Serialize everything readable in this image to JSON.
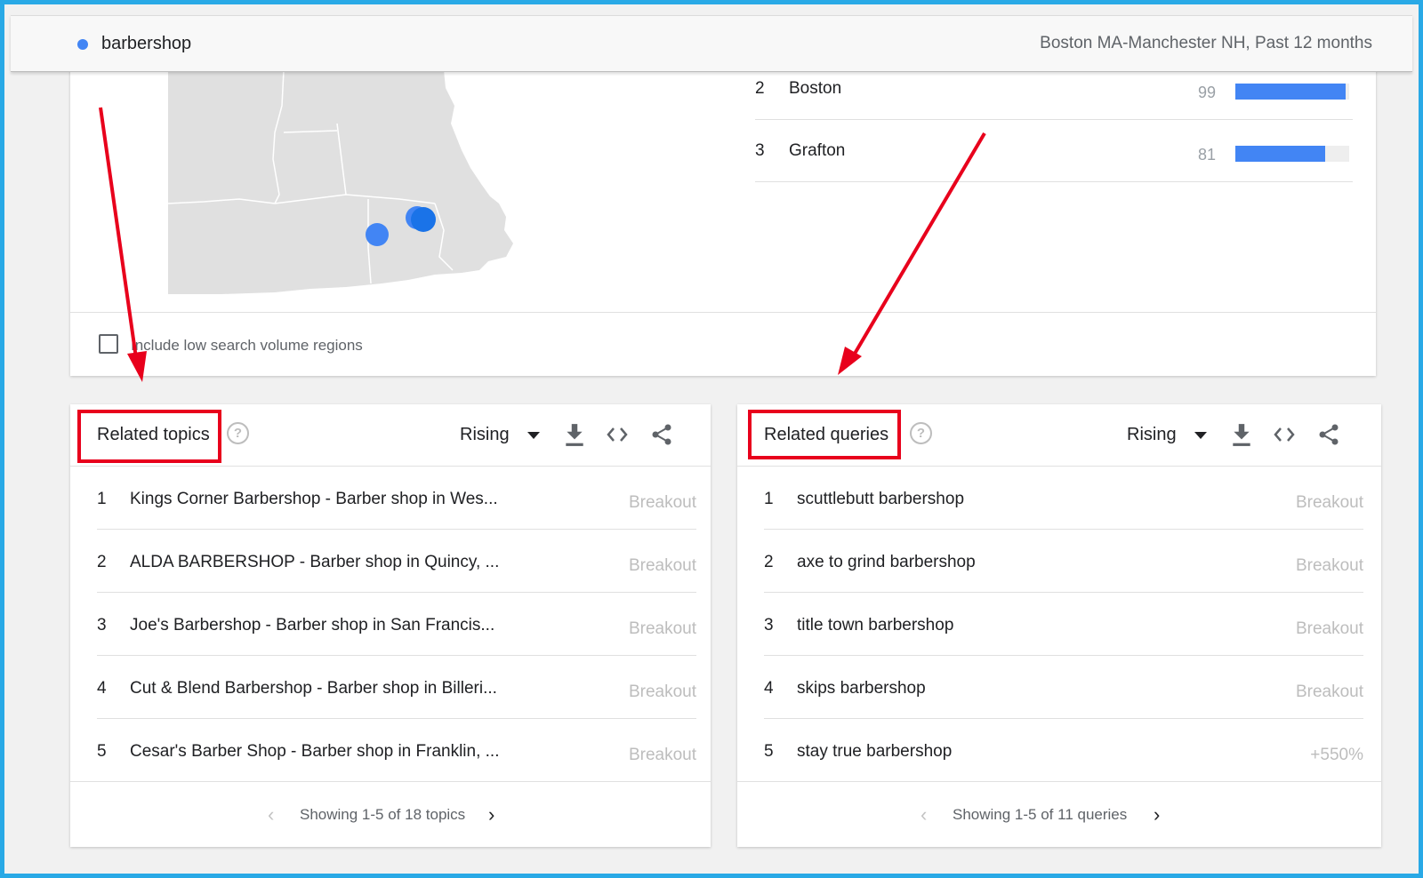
{
  "header": {
    "term": "barbershop",
    "region_period": "Boston MA-Manchester NH, Past 12 months",
    "dot_color": "#4285f4"
  },
  "map": {
    "markers_color": "#1a73e8",
    "checkbox_label": "Include low search volume regions",
    "rankings": [
      {
        "rank": "2",
        "name": "Boston",
        "value": "99",
        "fraction": 0.99
      },
      {
        "rank": "3",
        "name": "Grafton",
        "value": "81",
        "fraction": 0.81
      }
    ]
  },
  "related_topics": {
    "title": "Related topics",
    "help_icon": "help-circle-icon",
    "filter": "Rising",
    "rows": [
      {
        "rank": "1",
        "text": "Kings Corner Barbershop - Barber shop in Wes...",
        "metric": "Breakout"
      },
      {
        "rank": "2",
        "text": "ALDA BARBERSHOP - Barber shop in Quincy, ...",
        "metric": "Breakout"
      },
      {
        "rank": "3",
        "text": "Joe's Barbershop - Barber shop in San Francis...",
        "metric": "Breakout"
      },
      {
        "rank": "4",
        "text": "Cut & Blend Barbershop - Barber shop in Billeri...",
        "metric": "Breakout"
      },
      {
        "rank": "5",
        "text": "Cesar's Barber Shop - Barber shop in Franklin, ...",
        "metric": "Breakout"
      }
    ],
    "pager": "Showing 1-5 of 18 topics"
  },
  "related_queries": {
    "title": "Related queries",
    "help_icon": "help-circle-icon",
    "filter": "Rising",
    "rows": [
      {
        "rank": "1",
        "text": "scuttlebutt barbershop",
        "metric": "Breakout"
      },
      {
        "rank": "2",
        "text": "axe to grind barbershop",
        "metric": "Breakout"
      },
      {
        "rank": "3",
        "text": "title town barbershop",
        "metric": "Breakout"
      },
      {
        "rank": "4",
        "text": "skips barbershop",
        "metric": "Breakout"
      },
      {
        "rank": "5",
        "text": "stay true barbershop",
        "metric": "+550%"
      }
    ],
    "pager": "Showing 1-5 of 11 queries"
  },
  "annotation_color": "#e8001c",
  "frame_color": "#29a9e6"
}
